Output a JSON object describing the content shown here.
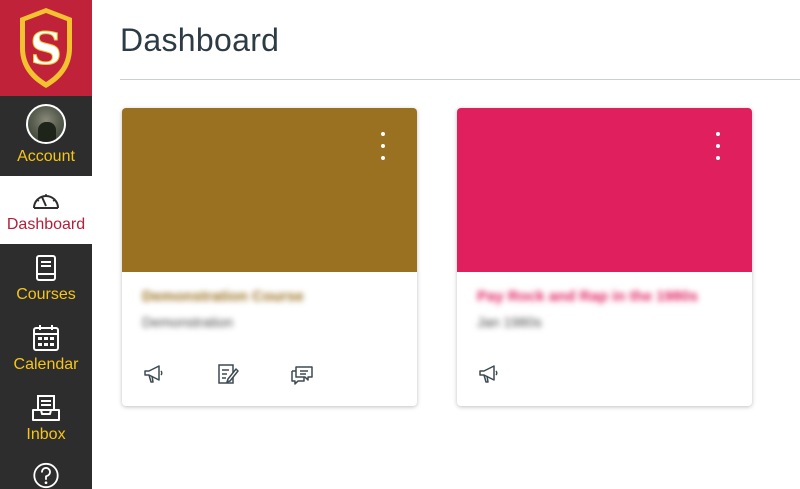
{
  "page": {
    "title": "Dashboard"
  },
  "sidebar": {
    "logo_letter": "S",
    "items": [
      {
        "label": "Account",
        "icon": "avatar"
      },
      {
        "label": "Dashboard",
        "icon": "speedometer-icon",
        "active": true
      },
      {
        "label": "Courses",
        "icon": "book-icon"
      },
      {
        "label": "Calendar",
        "icon": "calendar-icon"
      },
      {
        "label": "Inbox",
        "icon": "inbox-icon"
      },
      {
        "label": "",
        "icon": "help-icon"
      }
    ],
    "colors": {
      "background": "#2d2d2d",
      "logo_bg": "#c0223a",
      "label": "#f5c518",
      "active_label": "#b1213a"
    }
  },
  "cards": [
    {
      "name": "Demonstration Course",
      "term": "Demonstration",
      "color": "#9a7121",
      "actions": [
        "announcements-icon",
        "assignments-icon",
        "discussions-icon"
      ]
    },
    {
      "name": "Pay Rock and Rap in the 1980s",
      "term": "Jan 1980s",
      "color": "#e01f5f",
      "actions": [
        "announcements-icon"
      ]
    }
  ]
}
